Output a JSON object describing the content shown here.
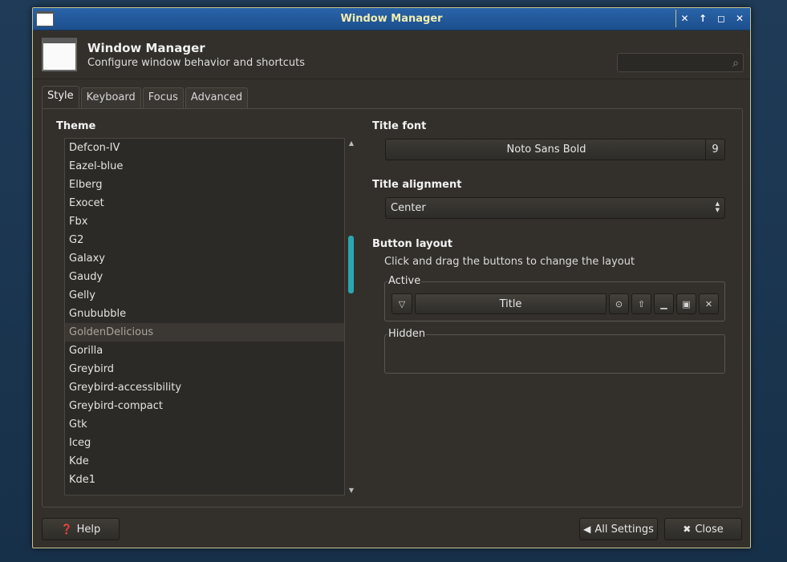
{
  "window": {
    "title": "Window Manager",
    "controls": [
      "pin-icon",
      "shade-icon",
      "maximize-icon",
      "close-icon"
    ]
  },
  "header": {
    "title": "Window Manager",
    "subtitle": "Configure window behavior and shortcuts",
    "search_value": ""
  },
  "tabs": [
    {
      "label": "Style",
      "active": true
    },
    {
      "label": "Keyboard",
      "active": false
    },
    {
      "label": "Focus",
      "active": false
    },
    {
      "label": "Advanced",
      "active": false
    }
  ],
  "theme": {
    "label": "Theme",
    "items": [
      "Defcon-IV",
      "Eazel-blue",
      "Elberg",
      "Exocet",
      "Fbx",
      "G2",
      "Galaxy",
      "Gaudy",
      "Gelly",
      "Gnububble",
      "GoldenDelicious",
      "Gorilla",
      "Greybird",
      "Greybird-accessibility",
      "Greybird-compact",
      "Gtk",
      "Iceg",
      "Kde",
      "Kde1"
    ],
    "selected": "GoldenDelicious"
  },
  "title_font": {
    "label": "Title font",
    "name": "Noto Sans Bold",
    "size": "9"
  },
  "title_alignment": {
    "label": "Title alignment",
    "value": "Center"
  },
  "button_layout": {
    "label": "Button layout",
    "hint": "Click and drag the buttons to change the layout",
    "active_label": "Active",
    "title_button": "Title",
    "hidden_label": "Hidden"
  },
  "footer": {
    "help": "Help",
    "all_settings": "All Settings",
    "close": "Close"
  },
  "colors": {
    "titlebar": "#1c4f8e",
    "title_text": "#f3eeb0",
    "accent_scroll": "#2aa6b3",
    "window_bg": "#33302b"
  }
}
